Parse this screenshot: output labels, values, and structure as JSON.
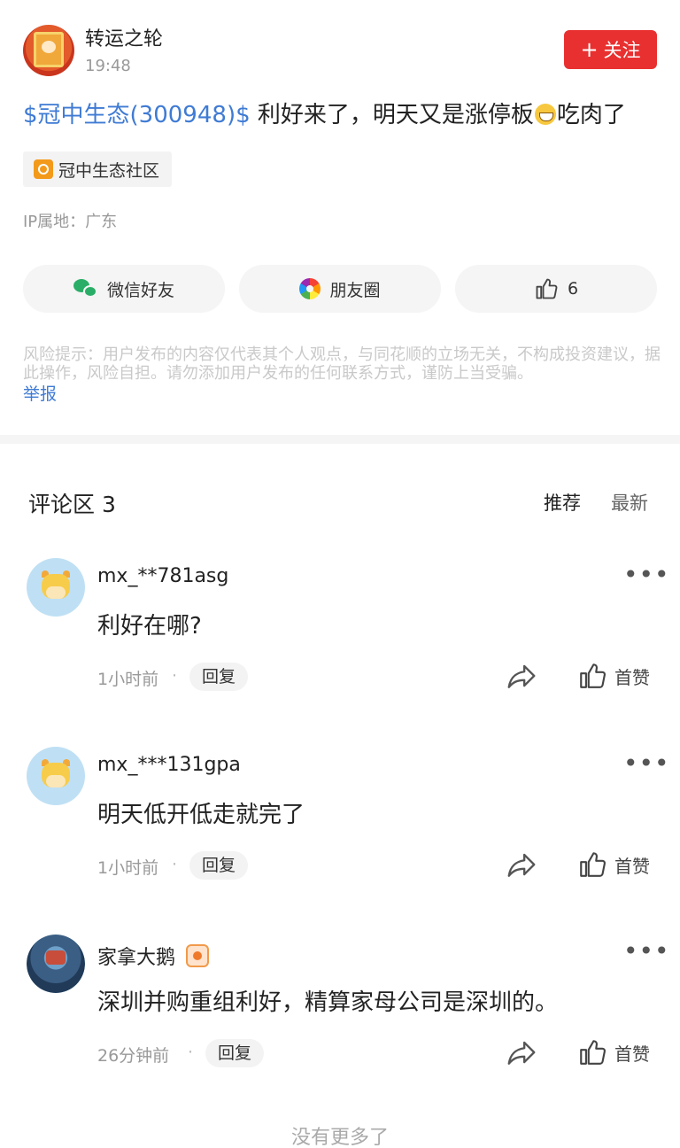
{
  "post": {
    "author": "转运之轮",
    "time": "19:48",
    "follow_label": "关注",
    "stock_link": "$冠中生态(300948)$",
    "text_before_emoji": " 利好来了，明天又是涨停板",
    "text_after_emoji": "吃肉了",
    "community": "冠中生态社区",
    "ip_location": "IP属地：广东"
  },
  "share": {
    "wechat_label": "微信好友",
    "moments_label": "朋友圈",
    "like_count": "6"
  },
  "risk": {
    "text": "风险提示：用户发布的内容仅代表其个人观点，与同花顺的立场无关，不构成投资建议，据此操作，风险自担。请勿添加用户发布的任何联系方式，谨防上当受骗。",
    "report_label": "举报"
  },
  "comments_section": {
    "title": "评论区 3",
    "sort_recommend": "推荐",
    "sort_latest": "最新",
    "items": [
      {
        "user": "mx_**781asg",
        "text": "利好在哪?",
        "time": "1小时前",
        "reply_label": "回复",
        "like_label": "首赞"
      },
      {
        "user": "mx_***131gpa",
        "text": "明天低开低走就完了",
        "time": "1小时前",
        "reply_label": "回复",
        "like_label": "首赞"
      },
      {
        "user": "家拿大鹅",
        "text": "深圳并购重组利好，精算家母公司是深圳的。",
        "time": "26分钟前",
        "reply_label": "回复",
        "like_label": "首赞"
      }
    ],
    "separator": "·",
    "more_label": "•••"
  },
  "footer": {
    "no_more": "没有更多了"
  },
  "colors": {
    "accent_red": "#e93030",
    "link_blue": "#3f7bd4"
  }
}
